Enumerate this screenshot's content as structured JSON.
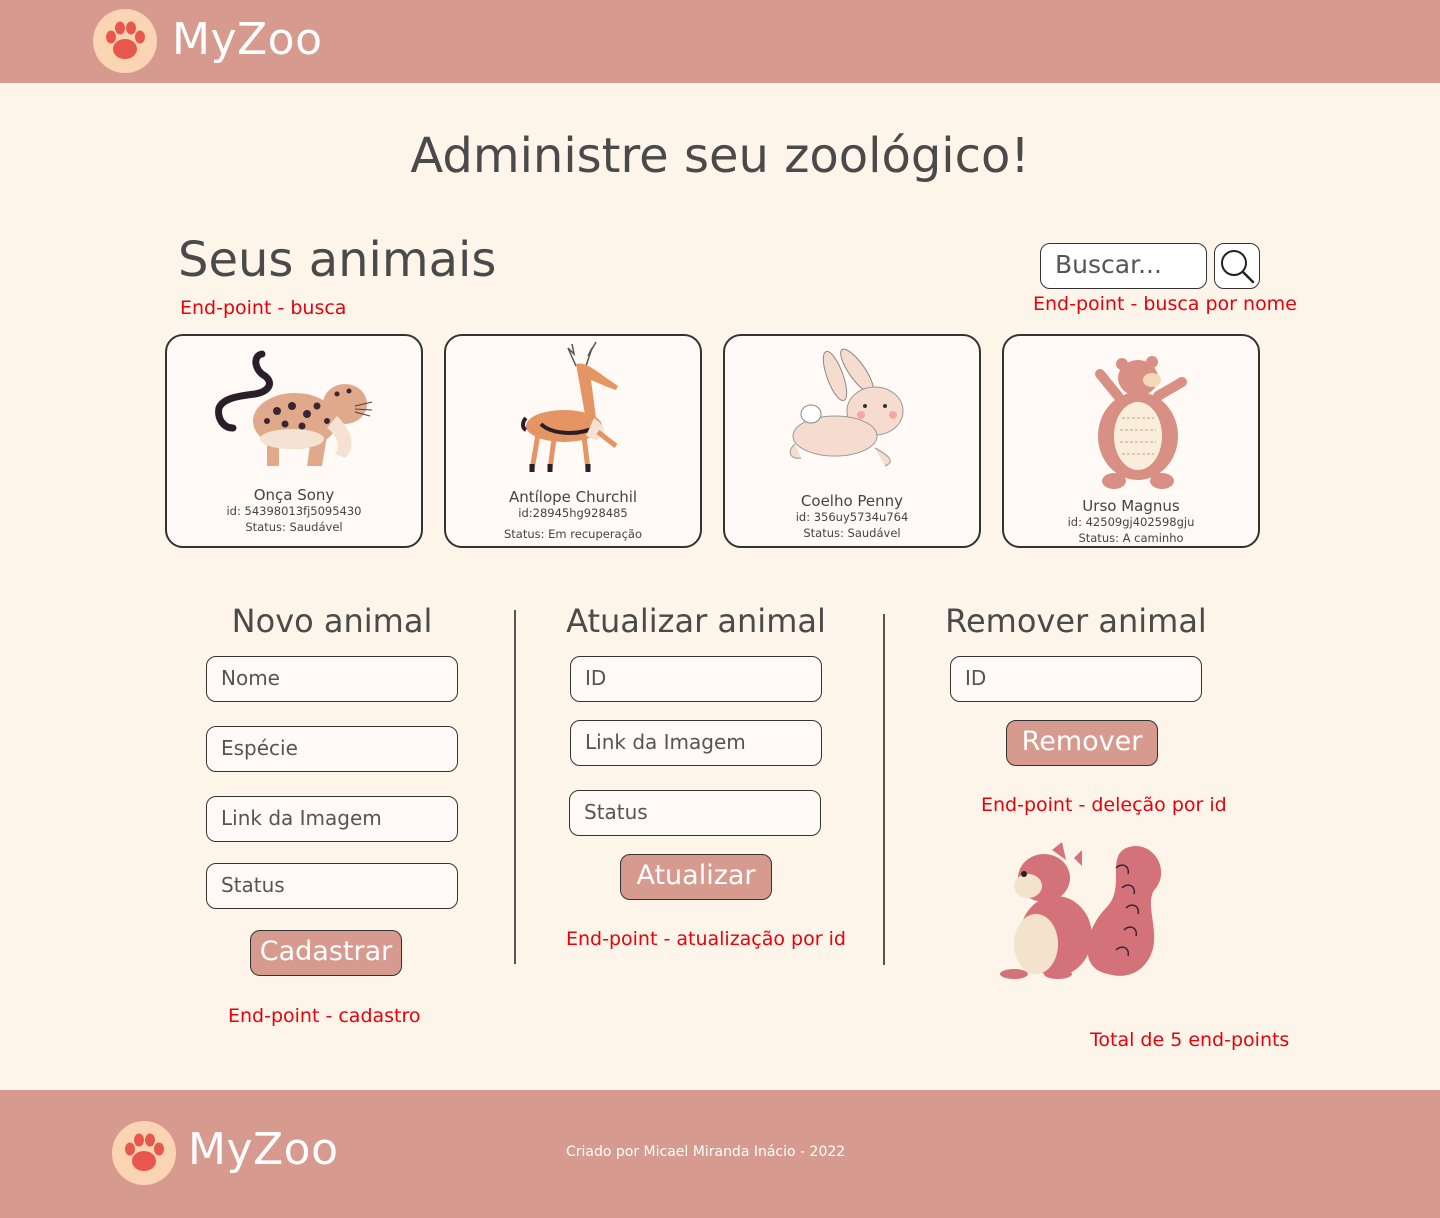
{
  "brand": {
    "name": "MyZoo"
  },
  "page": {
    "title": "Administre seu zoológico!"
  },
  "animals_section": {
    "title": "Seus animais",
    "note_list": "End-point - busca",
    "search_placeholder": "Buscar...",
    "note_search": "End-point - busca por nome"
  },
  "animals": [
    {
      "name": "Onça Sony",
      "id": "id: 54398013fj5095430",
      "status": "Status: Saudável",
      "icon": "jaguar-illustration"
    },
    {
      "name": "Antílope Churchil",
      "id": "id:28945hg928485",
      "status": "Status: Em recuperação",
      "icon": "antelope-illustration"
    },
    {
      "name": "Coelho Penny",
      "id": "id: 356uy5734u764",
      "status": "Status: Saudável",
      "icon": "rabbit-illustration"
    },
    {
      "name": "Urso Magnus",
      "id": "id: 42509gj402598gju",
      "status": "Status: A caminho",
      "icon": "bear-illustration"
    }
  ],
  "create": {
    "title": "Novo animal",
    "fields": [
      "Nome",
      "Espécie",
      "Link da Imagem",
      "Status"
    ],
    "button": "Cadastrar",
    "note": "End-point - cadastro"
  },
  "update": {
    "title": "Atualizar animal",
    "fields": [
      "ID",
      "Link da Imagem",
      "Status"
    ],
    "button": "Atualizar",
    "note": "End-point - atualização por id"
  },
  "remove": {
    "title": "Remover animal",
    "fields": [
      "ID"
    ],
    "button": "Remover",
    "note": "End-point - deleção por id",
    "icon": "squirrel-illustration"
  },
  "total_note": "Total de 5 end-points",
  "footer": {
    "brand": "MyZoo",
    "credit": "Criado por Micael Miranda Inácio - 2022"
  },
  "colors": {
    "header": "#D79A8F",
    "background": "#FEF5EA",
    "note": "#E8000B",
    "logo_badge": "#FBD4B4",
    "paw": "#E8564E"
  }
}
